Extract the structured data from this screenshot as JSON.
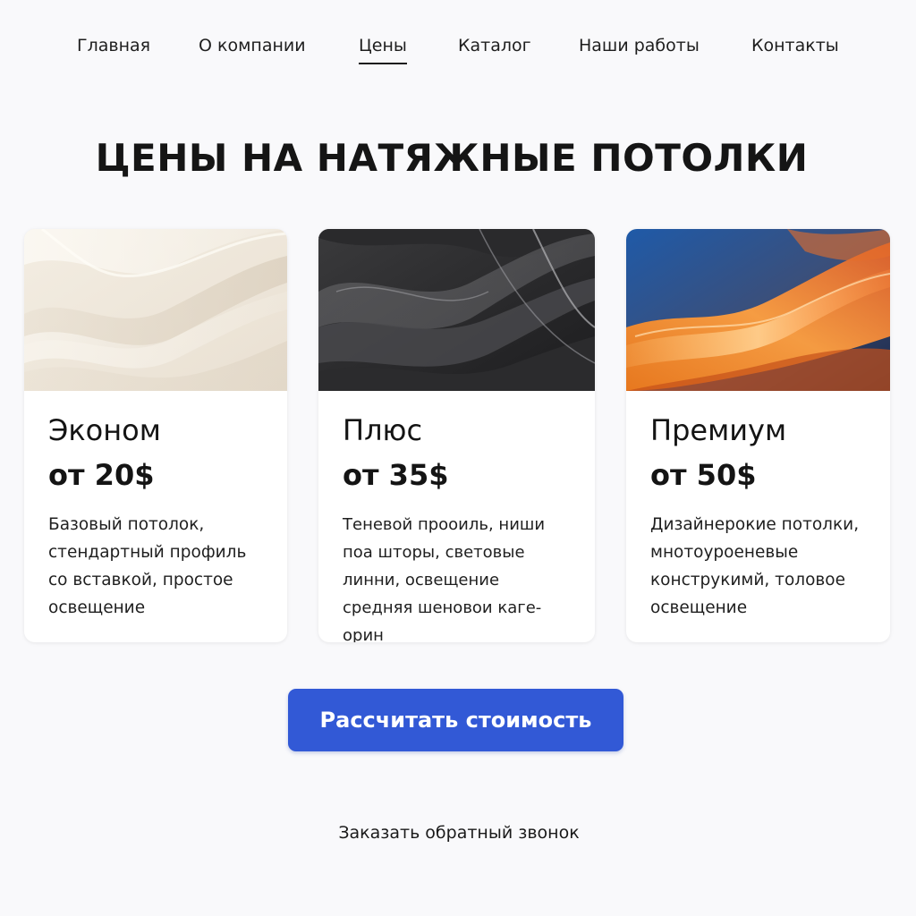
{
  "nav": {
    "items": [
      {
        "label": "Главная"
      },
      {
        "label": "О компании"
      },
      {
        "label": "Цены",
        "active": true
      },
      {
        "label": "Каталог"
      },
      {
        "label": "Наши работы"
      },
      {
        "label": "Контакты"
      }
    ]
  },
  "page": {
    "title": "ЦЕНЫ НА НАТЯЖНЫЕ ПОТОЛКИ"
  },
  "cards": [
    {
      "name": "Эконом",
      "price": "от 20$",
      "description": "Базовый потолок,\nстендартный профиль\nсо вставкой, простое\nосвещение",
      "image": "cream-wave-texture"
    },
    {
      "name": "Плюс",
      "price": "от 35$",
      "description": "Теневой прооиль, ниши\nпоа шторы, световые\nлинни, освещение\nсредняя шеновои каге-орин",
      "image": "dark-gray-wave-texture"
    },
    {
      "name": "Премиум",
      "price": "от 50$",
      "description": "Дизайнерокие потолки,\nмнотоуроеневые\nконструкимй, толовое\nосвещение",
      "image": "blue-orange-wave-texture"
    }
  ],
  "cta": {
    "label": "Рассчитать стоимость"
  },
  "callback": {
    "label": "Заказать обратный звонок"
  },
  "colors": {
    "accent": "#3259d6",
    "background": "#f9f9fb",
    "card": "#ffffff",
    "text": "#141414"
  }
}
